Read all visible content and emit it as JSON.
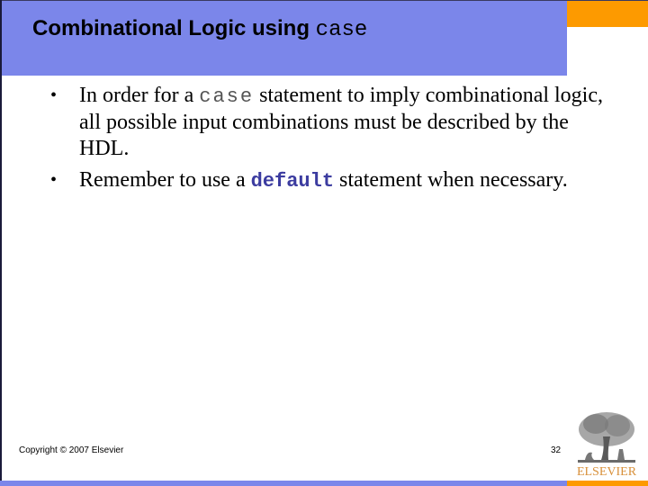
{
  "slide": {
    "title_text": "Combinational Logic using ",
    "title_code": "case",
    "bullets": [
      {
        "parts": [
          "In order for a ",
          "case",
          " statement to imply combinational logic, all possible input combinations must be described by the HDL."
        ]
      },
      {
        "parts": [
          "Remember to use a ",
          "default",
          " statement when necessary."
        ]
      }
    ],
    "bullet_symbol": "•",
    "footer": {
      "copyright": "Copyright © 2007 Elsevier",
      "page_number": "32"
    },
    "logo": {
      "icon": "elsevier-tree-icon",
      "text": "ELSEVIER"
    },
    "colors": {
      "title_bar": "#7b86ea",
      "accent_orange": "#fd9a00",
      "code_blue": "#3c3ca0",
      "logo_text": "#d8903a"
    }
  }
}
